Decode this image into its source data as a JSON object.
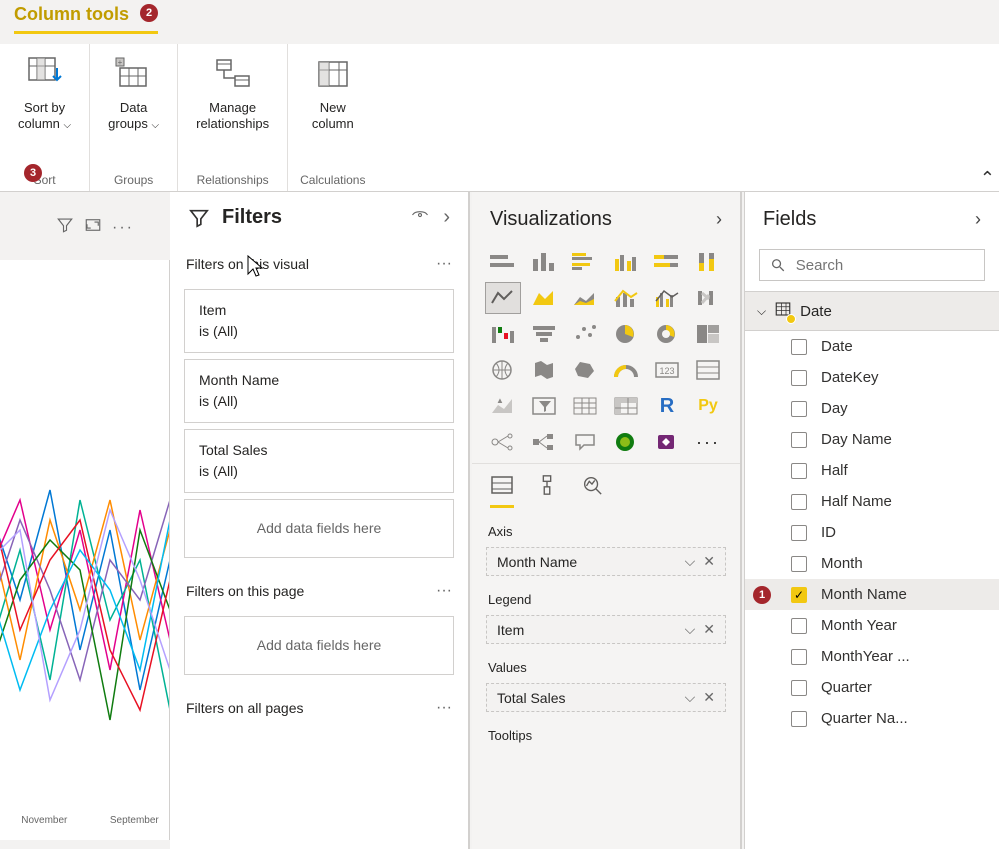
{
  "ribbon": {
    "tab_label": "Column tools",
    "tab_badge": "2",
    "sort": {
      "label": "Sort by\ncolumn",
      "group": "Sort",
      "badge": "3"
    },
    "groups": {
      "label": "Data\ngroups",
      "group": "Groups"
    },
    "relationships": {
      "label": "Manage\nrelationships",
      "group": "Relationships"
    },
    "calculations": {
      "label": "New\ncolumn",
      "group": "Calculations"
    }
  },
  "filters": {
    "title": "Filters",
    "section_visual": "Filters on this visual",
    "section_page": "Filters on this page",
    "section_all": "Filters on all pages",
    "cards": [
      {
        "name": "Item",
        "cond": "is (All)"
      },
      {
        "name": "Month Name",
        "cond": "is (All)"
      },
      {
        "name": "Total Sales",
        "cond": "is (All)"
      }
    ],
    "add_placeholder": "Add data fields here"
  },
  "viz": {
    "title": "Visualizations",
    "wells": {
      "axis": {
        "label": "Axis",
        "value": "Month Name"
      },
      "legend": {
        "label": "Legend",
        "value": "Item"
      },
      "values": {
        "label": "Values",
        "value": "Total Sales"
      },
      "tooltips": {
        "label": "Tooltips"
      }
    }
  },
  "fields": {
    "title": "Fields",
    "search_placeholder": "Search",
    "table": "Date",
    "items": [
      {
        "label": "Date",
        "checked": false
      },
      {
        "label": "DateKey",
        "checked": false
      },
      {
        "label": "Day",
        "checked": false
      },
      {
        "label": "Day Name",
        "checked": false
      },
      {
        "label": "Half",
        "checked": false
      },
      {
        "label": "Half Name",
        "checked": false
      },
      {
        "label": "ID",
        "checked": false
      },
      {
        "label": "Month",
        "checked": false
      },
      {
        "label": "Month Name",
        "checked": true,
        "badge": "1"
      },
      {
        "label": "Month Year",
        "checked": false
      },
      {
        "label": "MonthYear ...",
        "checked": false
      },
      {
        "label": "Quarter",
        "checked": false
      },
      {
        "label": "Quarter Na...",
        "checked": false
      }
    ]
  },
  "chart": {
    "x1": "November",
    "x2": "September"
  }
}
